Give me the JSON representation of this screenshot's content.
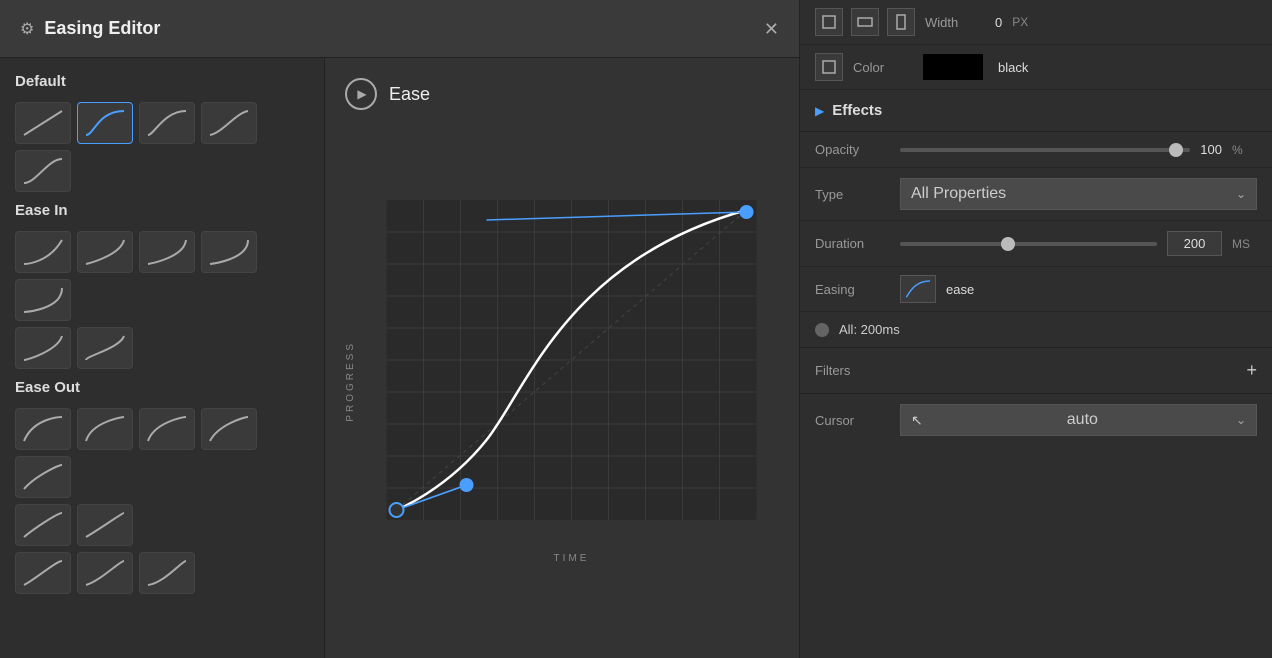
{
  "editor": {
    "title": "Easing Editor",
    "close_label": "✕",
    "gear": "⚙"
  },
  "presets": {
    "default_label": "Default",
    "ease_in_label": "Ease In",
    "ease_out_label": "Ease Out"
  },
  "curve": {
    "play_icon": "▶",
    "name": "Ease",
    "progress_label": "PROGRESS",
    "time_label": "TIME"
  },
  "right_panel": {
    "width_label": "Width",
    "width_value": "0",
    "width_unit": "PX",
    "color_label": "Color",
    "color_value": "black",
    "effects_title": "Effects",
    "opacity_label": "Opacity",
    "opacity_value": "100",
    "opacity_unit": "%",
    "type_label": "Type",
    "type_value": "All Properties",
    "duration_label": "Duration",
    "duration_value": "200",
    "duration_unit": "MS",
    "easing_label": "Easing",
    "easing_value": "ease",
    "all_label": "All: 200ms",
    "filters_label": "Filters",
    "plus_icon": "+",
    "cursor_label": "Cursor",
    "cursor_value": "auto"
  }
}
